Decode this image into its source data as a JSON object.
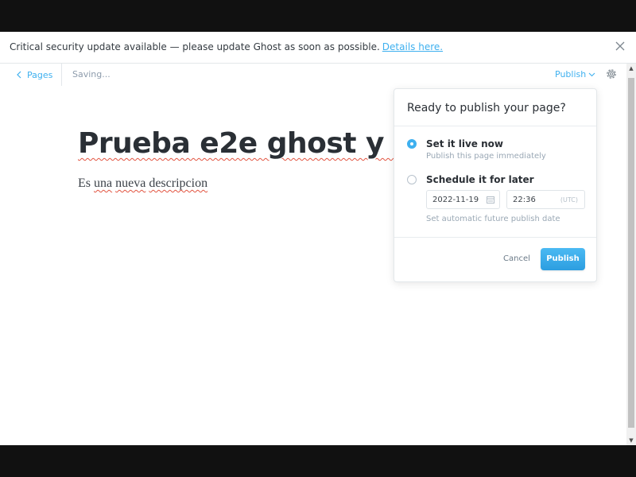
{
  "banner": {
    "message": "Critical security update available — please update Ghost as soon as possible.",
    "link_label": "Details here.",
    "close_icon": "close-icon"
  },
  "header": {
    "back_label": "Pages",
    "status": "Saving...",
    "publish_label": "Publish",
    "settings_icon": "gear-icon"
  },
  "editor": {
    "title": "Prueba e2e ghost y cy",
    "body": {
      "w1": "Es",
      "w2": "una",
      "w3": "nueva",
      "w4": "descripcion"
    }
  },
  "publish_menu": {
    "heading": "Ready to publish your page?",
    "options": [
      {
        "label": "Set it live now",
        "description": "Publish this page immediately",
        "selected": true
      },
      {
        "label": "Schedule it for later",
        "description": "Set automatic future publish date",
        "selected": false
      }
    ],
    "schedule": {
      "date": "2022-11-19",
      "time": "22:36",
      "timezone": "(UTC)"
    },
    "cancel_label": "Cancel",
    "publish_label": "Publish"
  },
  "colors": {
    "accent": "#3eb0ef",
    "text": "#2a2f35",
    "muted": "#9aa8b5"
  }
}
